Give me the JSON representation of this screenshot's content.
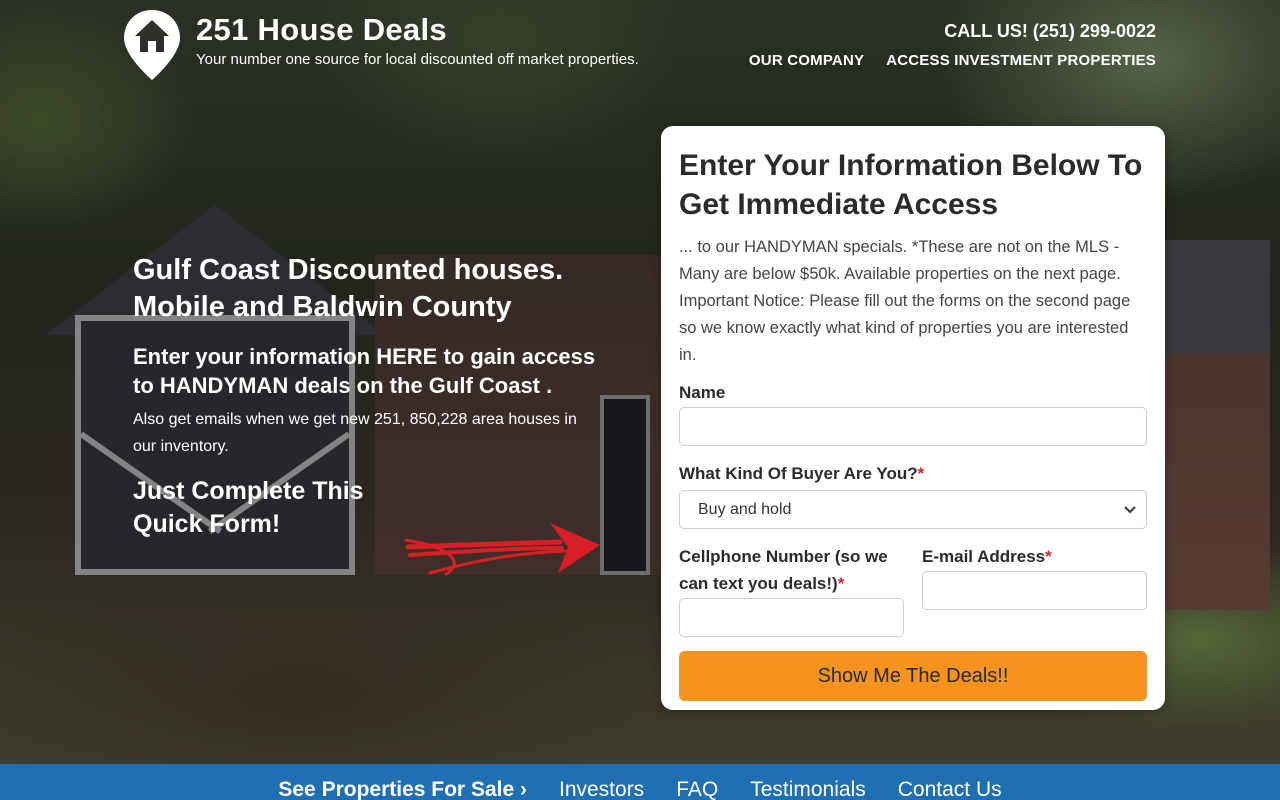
{
  "header": {
    "brand_title": "251 House Deals",
    "brand_subtitle": "Your number one source for local discounted off market properties.",
    "call": "CALL US! (251) 299-0022",
    "nav": [
      "OUR COMPANY",
      "ACCESS INVESTMENT PROPERTIES"
    ]
  },
  "hero": {
    "headline": "Gulf Coast Discounted houses. Mobile and Baldwin County",
    "subheadline": "Enter your information HERE to gain access to HANDYMAN deals on the Gulf Coast .",
    "paragraph": "Also get emails when we get new 251, 850,228 area houses in our inventory.",
    "cta_text": "Just Complete This Quick Form!"
  },
  "form": {
    "title": "Enter Your Information Below To Get Immediate Access",
    "intro": "... to our HANDYMAN specials. *These are not on the MLS - Many are below $50k. Available properties on the next page. Important Notice: Please fill out the forms on the second page so we know exactly what kind of properties you are interested in.",
    "name_label": "Name",
    "name_value": "",
    "buyer_label": "What Kind Of Buyer Are You?",
    "buyer_selected": "Buy and hold",
    "phone_label": "Cellphone Number (so we can text you deals!)",
    "phone_value": "",
    "email_label": "E-mail Address",
    "email_value": "",
    "required_mark": "*",
    "submit_label": "Show Me The Deals!!"
  },
  "bottom_nav": {
    "items": [
      "See Properties For Sale ›",
      "Investors",
      "FAQ",
      "Testimonials",
      "Contact Us"
    ]
  },
  "colors": {
    "accent_button": "#f7931e",
    "bottom_nav_bg": "#1f6fb2",
    "required": "#c62828",
    "arrow": "#d91f26"
  },
  "icons": [
    "house-pin-icon",
    "red-arrow-icon",
    "chevron-down-icon"
  ]
}
